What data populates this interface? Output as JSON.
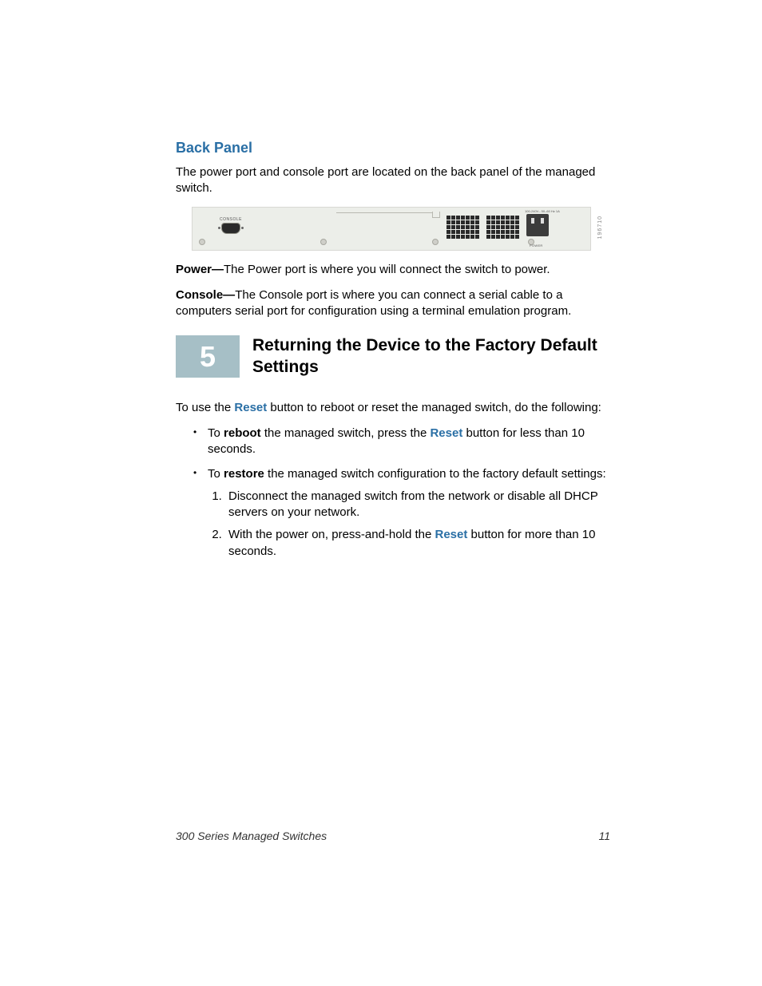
{
  "section_back_panel": {
    "title": "Back Panel",
    "intro": "The power port and console port are located on the back panel of the managed switch.",
    "diagram": {
      "console_label": "CONSOLE",
      "power_label_top": "100-240V–\n50–60 Hz 1A",
      "power_label_bottom": "POWER",
      "side_code": "196710"
    },
    "power_bold": "Power—",
    "power_text": "The Power port is where you will connect the switch to power.",
    "console_bold": "Console—",
    "console_text": "The Console port is where you can connect a serial cable to a computers serial port for configuration using a terminal emulation program."
  },
  "section5": {
    "number": "5",
    "title": "Returning the Device to the Factory Default Settings",
    "intro_pre": "To use the ",
    "intro_reset": "Reset",
    "intro_post": " button to reboot or reset the managed switch, do the following:",
    "bullets": [
      {
        "pre": "To ",
        "bold": "reboot",
        "mid": " the managed switch, press the ",
        "reset": "Reset",
        "post": " button for less than 10 seconds."
      },
      {
        "pre": "To ",
        "bold": "restore",
        "post": " the managed switch configuration to the factory default settings:",
        "numbered": [
          {
            "text": "Disconnect the managed switch from the network or disable all DHCP servers on your network."
          },
          {
            "pre": "With the power on, press-and-hold the ",
            "reset": "Reset",
            "post": " button for more than 10 seconds."
          }
        ]
      }
    ]
  },
  "footer": {
    "left": "300 Series Managed Switches",
    "right": "11"
  }
}
